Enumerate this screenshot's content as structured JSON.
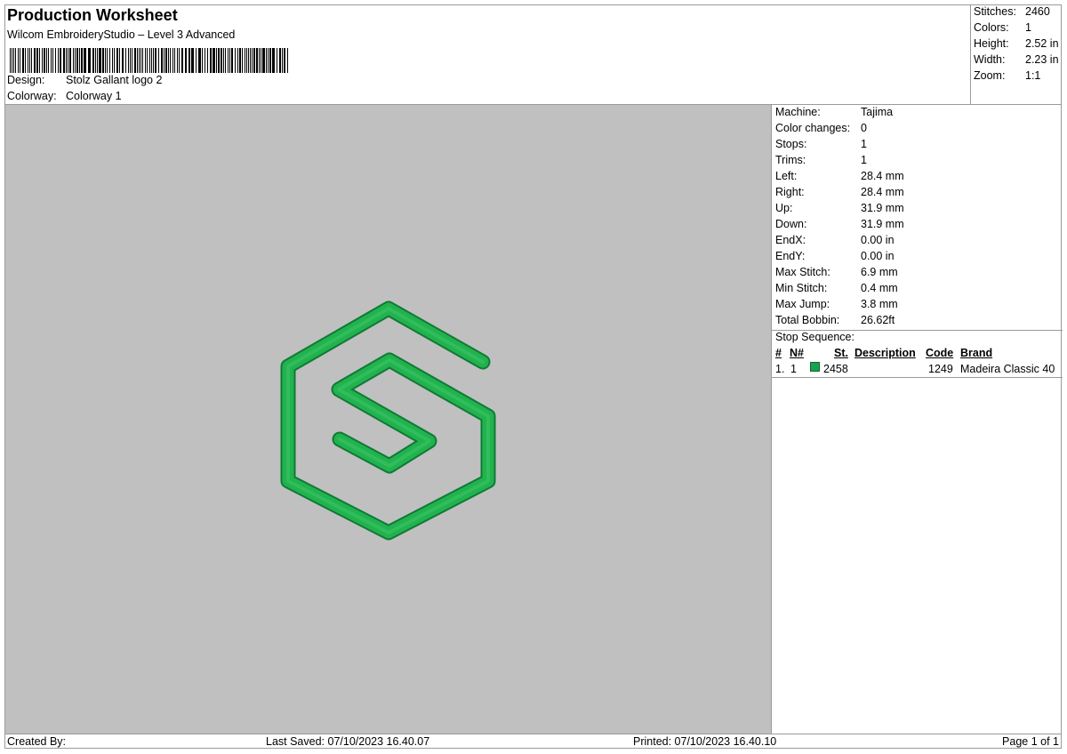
{
  "header": {
    "title": "Production Worksheet",
    "subtitle": "Wilcom EmbroideryStudio – Level 3 Advanced",
    "design_label": "Design:",
    "design_value": "Stolz Gallant logo 2",
    "colorway_label": "Colorway:",
    "colorway_value": "Colorway 1"
  },
  "stats": {
    "stitches_label": "Stitches:",
    "stitches_value": "2460",
    "colors_label": "Colors:",
    "colors_value": "1",
    "height_label": "Height:",
    "height_value": "2.52 in",
    "width_label": "Width:",
    "width_value": "2.23 in",
    "zoom_label": "Zoom:",
    "zoom_value": "1:1"
  },
  "info": [
    {
      "label": "Machine:",
      "value": "Tajima"
    },
    {
      "label": "Color changes:",
      "value": "0"
    },
    {
      "label": "Stops:",
      "value": "1"
    },
    {
      "label": "Trims:",
      "value": "1"
    },
    {
      "label": "Left:",
      "value": "28.4 mm"
    },
    {
      "label": "Right:",
      "value": "28.4 mm"
    },
    {
      "label": "Up:",
      "value": "31.9 mm"
    },
    {
      "label": "Down:",
      "value": "31.9 mm"
    },
    {
      "label": "EndX:",
      "value": "0.00 in"
    },
    {
      "label": "EndY:",
      "value": "0.00 in"
    },
    {
      "label": "Max Stitch:",
      "value": "6.9 mm"
    },
    {
      "label": "Min Stitch:",
      "value": "0.4 mm"
    },
    {
      "label": "Max Jump:",
      "value": "3.8 mm"
    },
    {
      "label": "Total Bobbin:",
      "value": "26.62ft"
    }
  ],
  "stop_sequence": {
    "title": "Stop Sequence:",
    "headers": {
      "num": "#",
      "needle": "N#",
      "stitches": "St.",
      "description": "Description",
      "code": "Code",
      "brand": "Brand"
    },
    "rows": [
      {
        "num": "1.",
        "needle": "1",
        "stitches": "2458",
        "description": "",
        "code": "1249",
        "brand": "Madeira Classic 40",
        "color": "#1aa050"
      }
    ]
  },
  "footer": {
    "created_by": "Created By:",
    "last_saved": "Last Saved: 07/10/2023 16.40.07",
    "printed": "Printed: 07/10/2023 16.40.10",
    "page": "Page 1 of 1"
  },
  "colors": {
    "canvas_bg": "#c0c0c0",
    "thread": "#1aa050"
  }
}
